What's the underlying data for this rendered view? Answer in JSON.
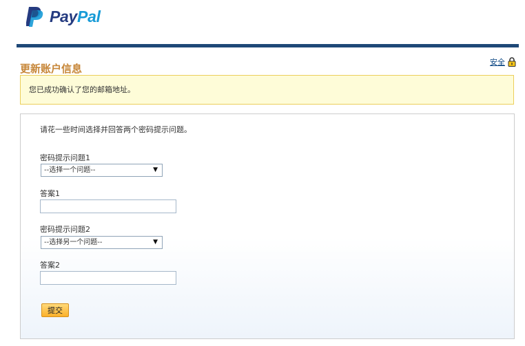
{
  "brand": {
    "logo_pay": "Pay",
    "logo_pal": "Pal",
    "color_dark_blue": "#253b80",
    "color_light_blue": "#179bd7"
  },
  "header": {
    "security_link": "安全",
    "page_title": "更新账户信息",
    "title_color": "#c7873a",
    "bar_color": "#1e4877"
  },
  "notice": {
    "message": "您已成功确认了您的邮箱地址。"
  },
  "form": {
    "intro": "请花一些时间选择并回答两个密码提示问题。",
    "question1": {
      "label": "密码提示问题1",
      "selected": "--选择一个问题--"
    },
    "answer1": {
      "label": "答案1",
      "value": ""
    },
    "question2": {
      "label": "密码提示问题2",
      "selected": "--选择另一个问题--"
    },
    "answer2": {
      "label": "答案2",
      "value": ""
    },
    "submit_label": "提交",
    "submit_color": "#fbb12a"
  }
}
